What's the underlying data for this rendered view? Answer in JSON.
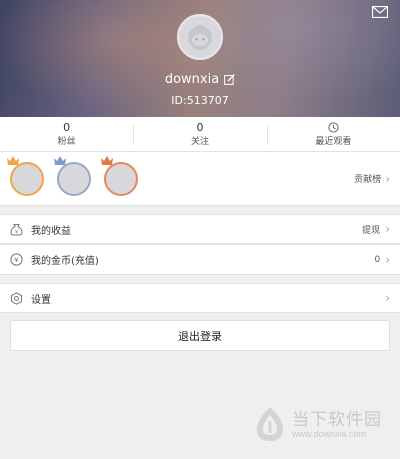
{
  "header": {
    "username": "downxia",
    "user_id": "ID:513707"
  },
  "stats": [
    {
      "value": "0",
      "label": "粉丝"
    },
    {
      "value": "0",
      "label": "关注"
    },
    {
      "icon": "clock-icon",
      "label": "最近观看"
    }
  ],
  "contributors": {
    "ranks": [
      "gold",
      "silver",
      "bronze"
    ],
    "link_label": "贡献榜"
  },
  "menu": {
    "earnings": {
      "label": "我的收益",
      "action": "提现"
    },
    "coins": {
      "label": "我的金币(充值)",
      "value": "0"
    },
    "settings": {
      "label": "设置"
    }
  },
  "logout_label": "退出登录",
  "watermark": {
    "name": "当下软件园",
    "url": "www.downxia.com"
  },
  "colors": {
    "gold": "#f2a44a",
    "silver": "#9aa8c8",
    "bronze": "#e08a5a",
    "background": "#efefef"
  }
}
